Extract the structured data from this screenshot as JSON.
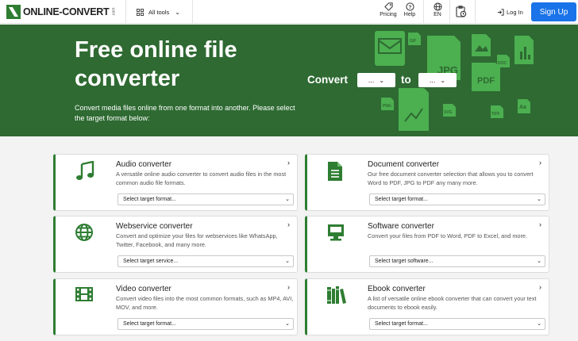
{
  "header": {
    "logo_text": "ONLINE-CONVERT",
    "logo_tld": ".com",
    "all_tools_label": "All tools",
    "pricing_label": "Pricing",
    "help_label": "Help",
    "language_label": "EN",
    "login_label": "Log In",
    "signup_label": "Sign Up"
  },
  "hero": {
    "title": "Free online file converter",
    "subtitle": "Convert media files online from one format into another. Please select the target format below:",
    "convert_label": "Convert",
    "to_label": "to",
    "from_select_value": "...",
    "to_select_value": "...",
    "deco_labels": [
      "JPG",
      "PDF",
      "GIF",
      "PNG",
      "SVG",
      "TIFF",
      "DOC",
      "Aa"
    ],
    "accent_color": "#2e6a32",
    "deco_color": "#4caf50"
  },
  "cards": [
    {
      "title": "Audio converter",
      "description": "A versatile online audio converter to convert audio files in the most common audio file formats.",
      "select": "Select target format...",
      "icon": "music-note-icon"
    },
    {
      "title": "Document converter",
      "description": "Our free document converter selection that allows you to convert Word to PDF, JPG to PDF any many more.",
      "select": "Select target format...",
      "icon": "document-icon"
    },
    {
      "title": "Webservice converter",
      "description": "Convert and optimize your files for webservices like WhatsApp, Twitter, Facebook, and many more.",
      "select": "Select target service...",
      "icon": "globe-icon"
    },
    {
      "title": "Software converter",
      "description": "Convert your files from PDF to Word, PDF to Excel, and more.",
      "select": "Select target software...",
      "icon": "monitor-icon"
    },
    {
      "title": "Video converter",
      "description": "Convert video files into the most common formats, such as MP4, AVI, MOV, and more.",
      "select": "Select target format...",
      "icon": "film-icon"
    },
    {
      "title": "Ebook converter",
      "description": "A list of versatile online ebook converter that can convert your text documents to ebook easily.",
      "select": "Select target format...",
      "icon": "books-icon"
    }
  ],
  "colors": {
    "brand_green": "#2e7d32",
    "signup_blue": "#1a73e8"
  }
}
